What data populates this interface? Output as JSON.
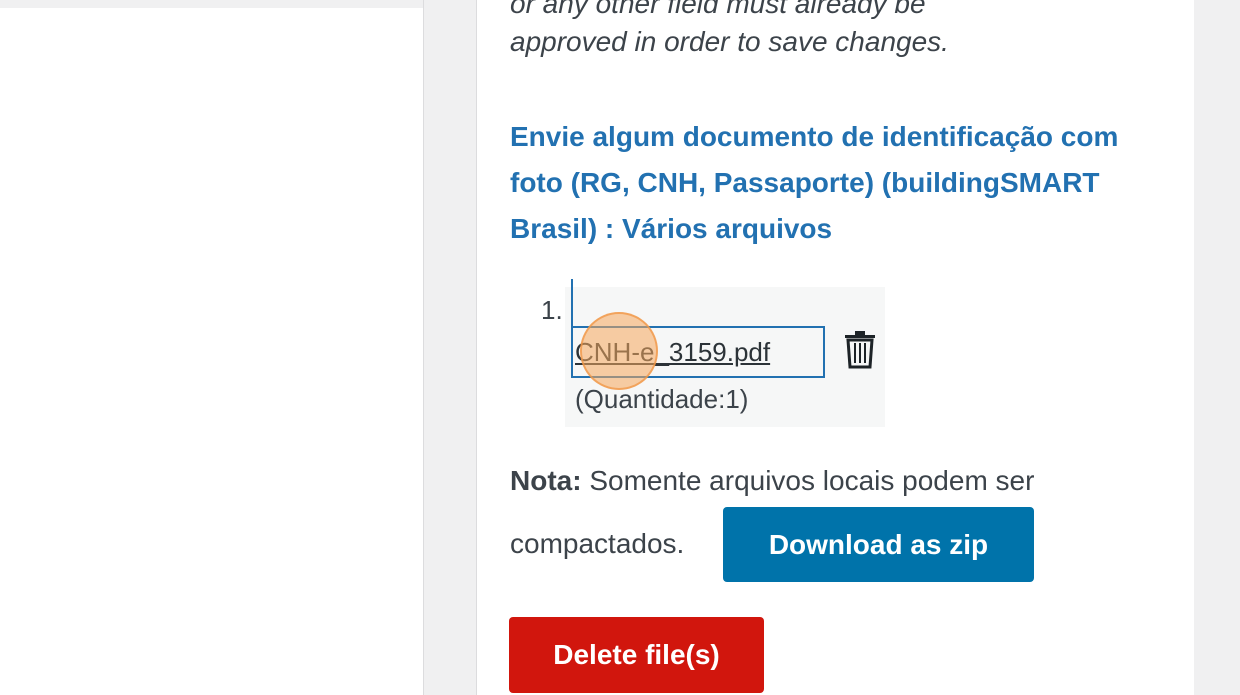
{
  "notice": {
    "cut_text": "or any other field must already be",
    "text": "approved in order to save changes."
  },
  "field": {
    "title": "Envie algum documento de identificação com foto (RG, CNH, Passaporte) (buildingSMART Brasil) : Vários arquivos"
  },
  "files": [
    {
      "number": "1.",
      "name": "CNH-e_3159.pdf",
      "quantity": "(Quantidade:1)",
      "delete_icon": "trash-icon"
    }
  ],
  "note": {
    "label": "Nota:",
    "text_line1": " Somente arquivos locais podem ser",
    "text_line2": "compactados."
  },
  "buttons": {
    "download_zip": "Download as zip",
    "delete_files": "Delete file(s)"
  },
  "colors": {
    "accent": "#2271b1",
    "download_button": "#0073aa",
    "delete_button": "#d1160d",
    "click_marker": "#f6a85c"
  }
}
